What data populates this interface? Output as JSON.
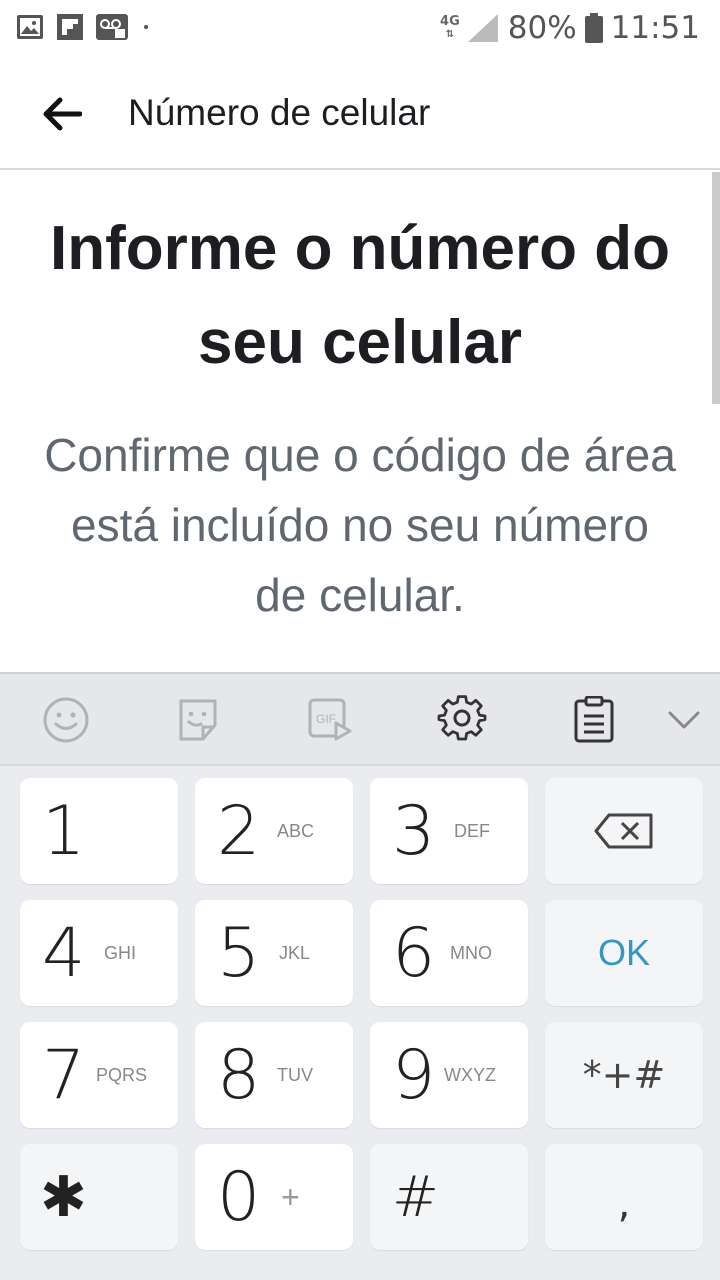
{
  "status_bar": {
    "network": "4G",
    "battery": "80%",
    "time": "11:51"
  },
  "app_bar": {
    "title": "Número de celular"
  },
  "content": {
    "headline": "Informe o número do seu celular",
    "subtext": "Confirme que o código de área está incluído no seu número de celular."
  },
  "keyboard": {
    "toolbar": [
      "emoji-icon",
      "sticker-icon",
      "gif-icon",
      "settings-icon",
      "clipboard-icon",
      "chevron-down-icon"
    ],
    "gif_label": "GIF",
    "keys": {
      "k1": {
        "main": "1",
        "sub": ""
      },
      "k2": {
        "main": "2",
        "sub": "ABC"
      },
      "k3": {
        "main": "3",
        "sub": "DEF"
      },
      "k4": {
        "main": "4",
        "sub": "GHI"
      },
      "k5": {
        "main": "5",
        "sub": "JKL"
      },
      "k6": {
        "main": "6",
        "sub": "MNO"
      },
      "k7": {
        "main": "7",
        "sub": "PQRS"
      },
      "k8": {
        "main": "8",
        "sub": "TUV"
      },
      "k9": {
        "main": "9",
        "sub": "WXYZ"
      },
      "k0": {
        "main": "0",
        "sub": "+"
      },
      "star": "✱",
      "hash": "#",
      "ok": "OK",
      "symbols": "*+#",
      "comma": ","
    },
    "accent_color": "#3596be"
  }
}
